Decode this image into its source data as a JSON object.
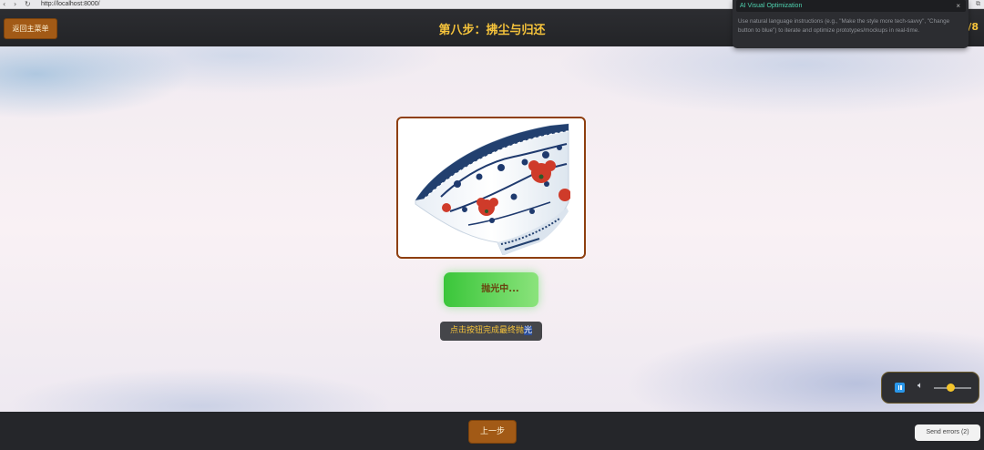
{
  "browser": {
    "url": "http://localhost:8000/",
    "back_icon": "chevron-left-icon",
    "forward_icon": "chevron-right-icon",
    "reload_icon": "reload-icon"
  },
  "header": {
    "back_button": "返回主菜单",
    "title": "第八步：拂尘与归还",
    "step_counter": "/8"
  },
  "main": {
    "polish_button": "抛光中...",
    "hint_prefix": "点击按钮完成最终抛",
    "hint_highlight": "光"
  },
  "audio": {
    "pause_icon": "pause-icon",
    "volume_icon": "speaker-icon",
    "volume_level": 0.45
  },
  "footer": {
    "prev_button": "上一步",
    "send_errors": "Send errors (2)"
  },
  "ai_panel": {
    "title": "AI Visual Optimization",
    "close": "×",
    "description": "Use natural language instructions (e.g., \"Make the style more tech-savvy\", \"Change button to blue\") to iterate and optimize prototypes/mockups in real-time."
  },
  "colors": {
    "accent_gold": "#f5c33b",
    "button_brown": "#a25a16",
    "polish_green": "#3ac63a",
    "frame_brown": "#8e3f0f",
    "ai_teal": "#4fd3b0"
  }
}
